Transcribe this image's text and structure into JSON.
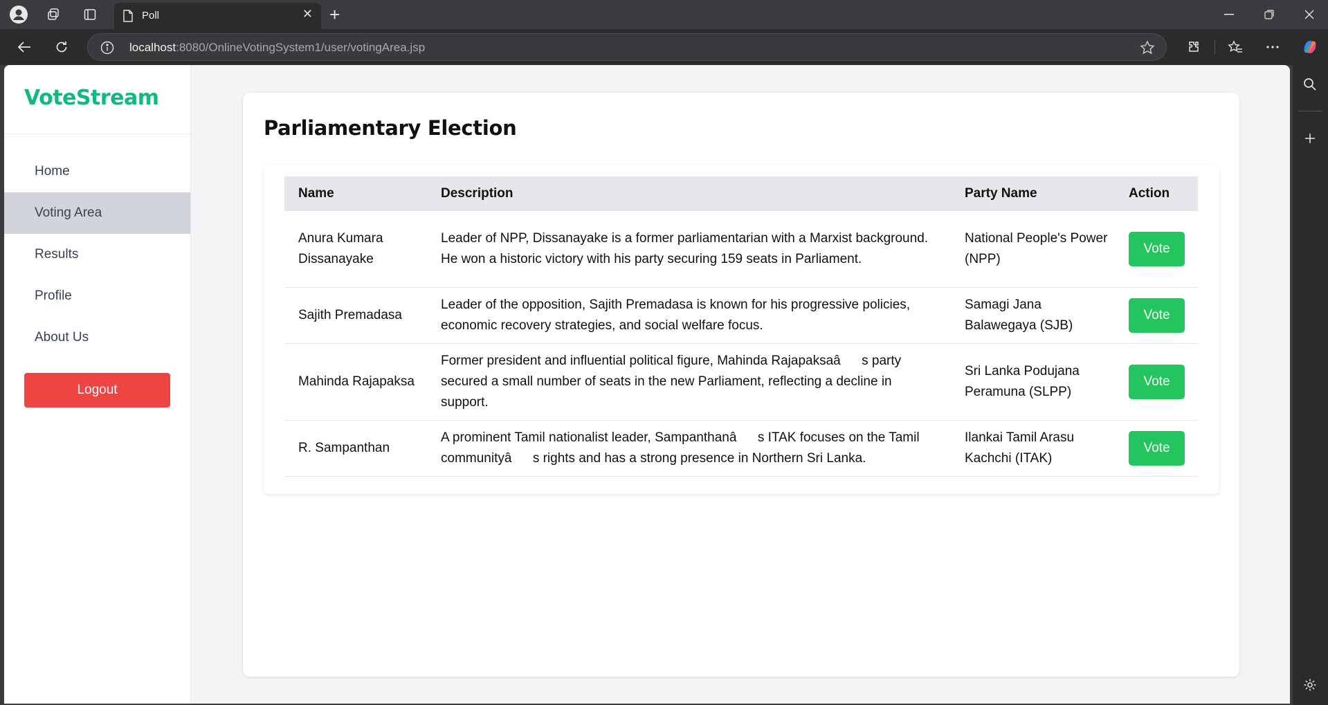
{
  "browser": {
    "tab_title": "Poll",
    "url_host": "localhost",
    "url_path": ":8080/OnlineVotingSystem1/user/votingArea.jsp"
  },
  "sidebar": {
    "brand": "VoteStream",
    "items": [
      {
        "label": "Home",
        "active": false
      },
      {
        "label": "Voting Area",
        "active": true
      },
      {
        "label": "Results",
        "active": false
      },
      {
        "label": "Profile",
        "active": false
      },
      {
        "label": "About Us",
        "active": false
      }
    ],
    "logout_label": "Logout"
  },
  "main": {
    "title": "Parliamentary Election",
    "columns": [
      "Name",
      "Description",
      "Party Name",
      "Action"
    ],
    "rows": [
      {
        "name": "Anura Kumara Dissanayake",
        "description": "Leader of NPP, Dissanayake is a former parliamentarian with a Marxist background. He won a historic victory with his party securing 159 seats in Parliament.",
        "party": "National People's Power (NPP)",
        "action": "Vote"
      },
      {
        "name": "Sajith Premadasa",
        "description": "Leader of the opposition, Sajith Premadasa is known for his progressive policies, economic recovery strategies, and social welfare focus.",
        "party": "Samagi Jana Balawegaya (SJB)",
        "action": "Vote"
      },
      {
        "name": "Mahinda Rajapaksa",
        "description": "Former president and influential political figure, Mahinda Rajapaksaâs party secured a small number of seats in the new Parliament, reflecting a decline in support.",
        "party": "Sri Lanka Podujana Peramuna (SLPP)",
        "action": "Vote"
      },
      {
        "name": "R. Sampanthan",
        "description": "A prominent Tamil nationalist leader, Sampanthanâs ITAK focuses on the Tamil communityâs rights and has a strong presence in Northern Sri Lanka.",
        "party": "Ilankai Tamil Arasu Kachchi (ITAK)",
        "action": "Vote"
      }
    ]
  },
  "colors": {
    "brand": "#10b981",
    "logout": "#ef4444",
    "vote": "#22c55e",
    "active_nav": "#d1d5db"
  }
}
